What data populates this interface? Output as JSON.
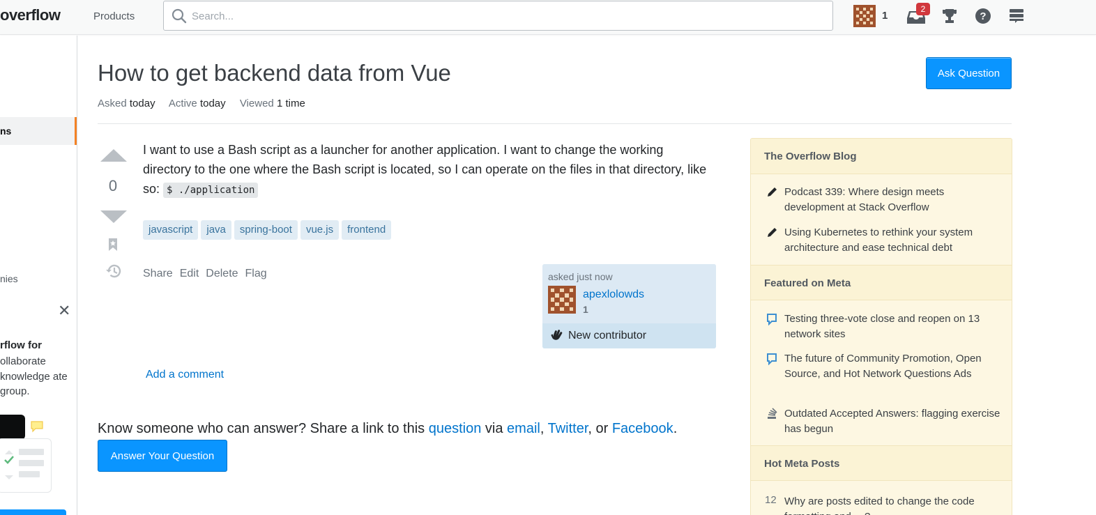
{
  "topbar": {
    "logo_text": "overflow",
    "products": "Products",
    "search_placeholder": "Search...",
    "reputation": "1",
    "inbox_count": "2"
  },
  "sidebar": {
    "active_item": "ns",
    "companies_item": "nies",
    "close": "✕",
    "teams_title": "rflow for",
    "teams_desc": "ollaborate knowledge ate group."
  },
  "question": {
    "title": "How to get backend data from Vue",
    "ask_button": "Ask Question",
    "meta": {
      "asked_label": "Asked",
      "asked_value": "today",
      "active_label": "Active",
      "active_value": "today",
      "viewed_label": "Viewed",
      "viewed_value": "1 time"
    },
    "votes": "0",
    "body_text": "I want to use a Bash script as a launcher for another application. I want to change the working directory to the one where the Bash script is located, so I can operate on the files in that directory, like so: ",
    "body_code": "$ ./application",
    "tags": [
      "javascript",
      "java",
      "spring-boot",
      "vue.js",
      "frontend"
    ],
    "menu": [
      "Share",
      "Edit",
      "Delete",
      "Flag"
    ],
    "user_card": {
      "asked_time": "asked just now",
      "username": "apexlolowds",
      "reputation": "1",
      "new_contributor": "New contributor"
    },
    "add_comment": "Add a comment"
  },
  "share": {
    "prefix": "Know someone who can answer? Share a link to this ",
    "question_link": "question",
    "via": " via ",
    "email": "email",
    "comma": ", ",
    "twitter": "Twitter",
    "or": ", or ",
    "facebook": "Facebook",
    "period": ".",
    "answer_button": "Answer Your Question"
  },
  "widget": {
    "blog_title": "The Overflow Blog",
    "blog_items": [
      "Podcast 339: Where design meets development at Stack Overflow",
      "Using Kubernetes to rethink your system architecture and ease technical debt"
    ],
    "meta_title": "Featured on Meta",
    "meta_items": [
      "Testing three-vote close and reopen on 13 network sites",
      "The future of Community Promotion, Open Source, and Hot Network Questions Ads",
      "Outdated Accepted Answers: flagging exercise has begun"
    ],
    "hot_title": "Hot Meta Posts",
    "hot_items": [
      {
        "count": "12",
        "text": "Why are posts edited to change the code formatting and …?"
      }
    ]
  },
  "colors": {
    "accent_blue": "#0a95ff",
    "link_blue": "#0074cc",
    "orange": "#f48225",
    "tag_bg": "#e1ecf4",
    "widget_bg": "#fdf7e2"
  }
}
